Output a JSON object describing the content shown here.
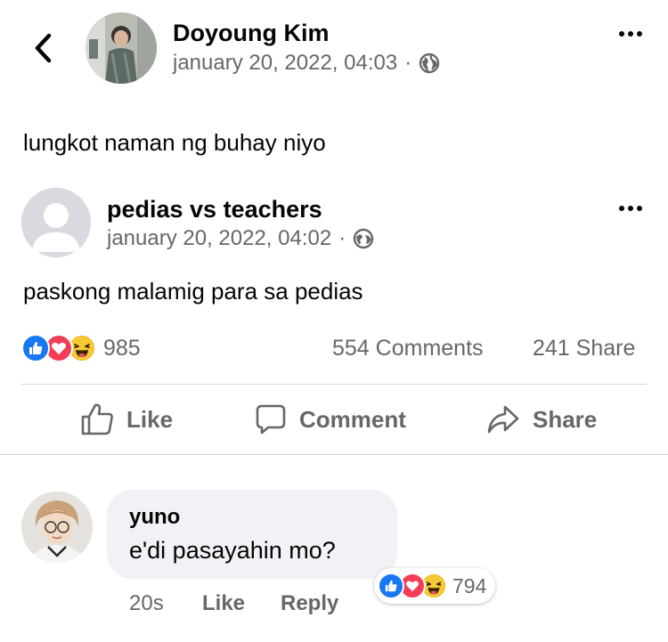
{
  "post": {
    "author": "Doyoung Kim",
    "timestamp": "january 20, 2022, 04:03",
    "separator": "·",
    "text": "lungkot naman ng buhay niyo"
  },
  "shared_post": {
    "author": "pedias vs teachers",
    "timestamp": "january 20, 2022, 04:02",
    "separator": "·",
    "text": "paskong malamig para sa pedias"
  },
  "stats": {
    "reaction_count": "985",
    "comments": "554 Comments",
    "shares": "241 Share"
  },
  "actions": {
    "like": "Like",
    "comment": "Comment",
    "share": "Share"
  },
  "comment": {
    "author": "yuno",
    "text": "e'di pasayahin mo?",
    "reaction_count": "794",
    "time": "20s",
    "like": "Like",
    "reply": "Reply"
  },
  "icons": {
    "back": "chevron-left-icon",
    "more": "more-dots-icon",
    "privacy": "globe-icon",
    "like_reaction": "like-reaction-icon",
    "love_reaction": "love-reaction-icon",
    "haha_reaction": "haha-reaction-icon"
  },
  "colors": {
    "like_blue": "#1877f2",
    "love_red": "#f33e58",
    "haha_yellow": "#f7b125",
    "secondary_text": "#65676b",
    "bubble_bg": "#f0f2f5"
  }
}
